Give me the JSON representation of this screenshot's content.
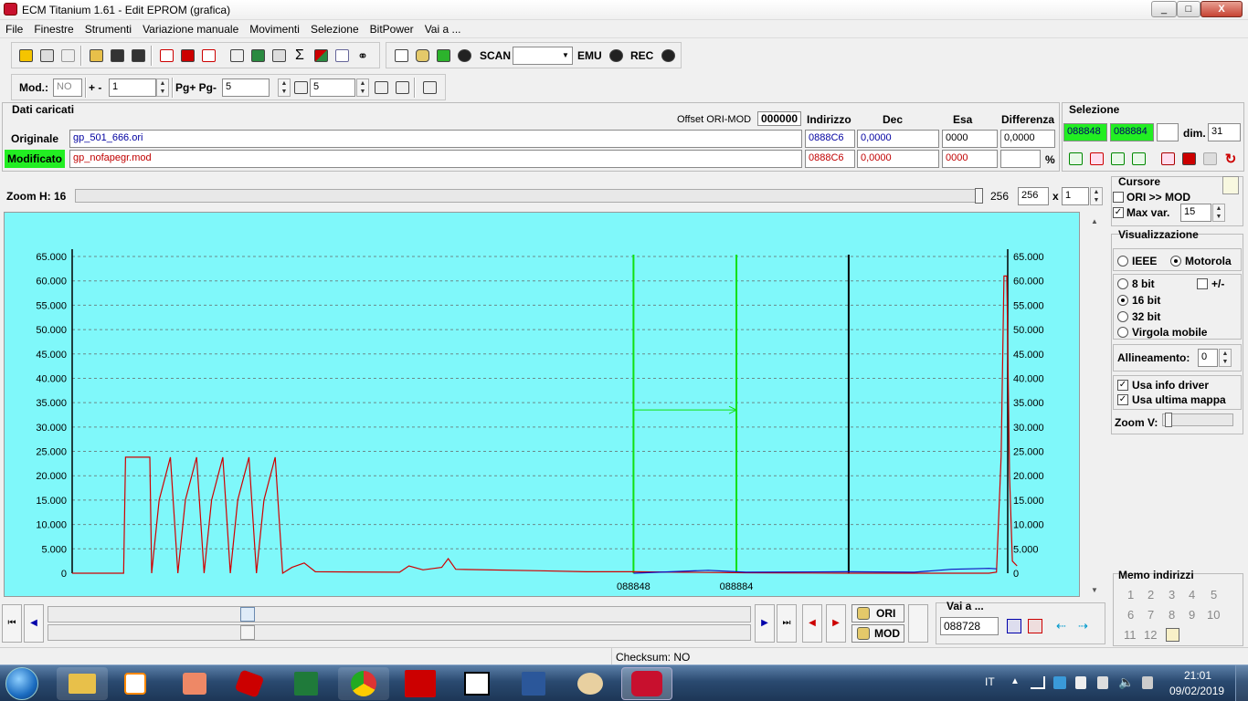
{
  "window": {
    "title": "ECM Titanium 1.61 - Edit EPROM (grafica)",
    "min": "_",
    "max": "□",
    "close": "X"
  },
  "menu": [
    "File",
    "Finestre",
    "Strumenti",
    "Variazione manuale",
    "Movimenti",
    "Selezione",
    "BitPower",
    "Vai a ..."
  ],
  "toolbar": {
    "scan_label": "SCAN",
    "emu_label": "EMU",
    "rec_label": "REC",
    "mod_label": "Mod.:",
    "mod_value": "NO",
    "plusminus_label": "+ -",
    "plusminus_value": "1",
    "pg_label": "Pg+ Pg-",
    "pg_value": "5",
    "p_value": "5"
  },
  "loaded": {
    "title": "Dati caricati",
    "offset_label": "Offset ORI-MOD",
    "offset_value": "000000",
    "col_indirizzo": "Indirizzo",
    "col_dec": "Dec",
    "col_esa": "Esa",
    "col_diff": "Differenza",
    "originale_label": "Originale",
    "originale_file": "gp_501_666.ori",
    "originale_addr": "0888C6",
    "originale_dec": "0,0000",
    "originale_esa": "0000",
    "originale_diff": "0,0000",
    "modificato_label": "Modificato",
    "modificato_file": "gp_nofapegr.mod",
    "modificato_addr": "0888C6",
    "modificato_dec": "0,0000",
    "modificato_esa": "0000",
    "percent": "%"
  },
  "selezione": {
    "title": "Selezione",
    "start": "088848",
    "end": "088884",
    "dim_label": "dim.",
    "dim_value": "31"
  },
  "zoom": {
    "label": "Zoom H: 16",
    "value1": "256",
    "value2": "256",
    "x": "x",
    "mult": "1",
    "slider_position": 1.0
  },
  "cursore": {
    "title": "Cursore",
    "ori_mod": "ORI >> MOD",
    "ori_mod_checked": false,
    "max_var": "Max var.",
    "max_var_checked": true,
    "max_var_value": "15"
  },
  "visualizzazione": {
    "title": "Visualizzazione",
    "ieee": "IEEE",
    "motorola": "Motorola",
    "bit8": "8 bit",
    "plusminus": "+/-",
    "bit16": "16 bit",
    "bit32": "32 bit",
    "virgola": "Virgola mobile",
    "allineamento_label": "Allineamento:",
    "allineamento_value": "0",
    "usa_info": "Usa info driver",
    "usa_ultima": "Usa ultima mappa",
    "zoom_v": "Zoom V:"
  },
  "memo": {
    "title": "Memo indirizzi",
    "numbers": [
      "1",
      "2",
      "3",
      "4",
      "5",
      "6",
      "7",
      "8",
      "9",
      "10",
      "11",
      "12"
    ]
  },
  "bottom": {
    "ori_btn": "ORI",
    "mod_btn": "MOD",
    "vai_label": "Vai a ...",
    "vai_value": "088728",
    "checksum": "Checksum: NO"
  },
  "taskbar": {
    "lang": "IT",
    "time": "21:01",
    "date": "09/02/2019",
    "apps": [
      "explorer",
      "media",
      "setup",
      "gem",
      "excel",
      "chrome",
      "ecm",
      "7z",
      "word",
      "paint",
      "ecm-titanium"
    ]
  },
  "chart_data": {
    "type": "line",
    "ylim": [
      0,
      65000
    ],
    "yticks": [
      "65.000",
      "60.000",
      "55.000",
      "50.000",
      "45.000",
      "40.000",
      "35.000",
      "30.000",
      "25.000",
      "20.000",
      "15.000",
      "10.000",
      "5.000",
      "0"
    ],
    "xtick_labels": [
      "088848",
      "088884"
    ],
    "selection_start_x": 0.6,
    "selection_end_x": 0.71,
    "cursor_x": 0.83,
    "series": [
      {
        "color": "#d00000",
        "points": [
          [
            0,
            0
          ],
          [
            0.055,
            0
          ],
          [
            0.057,
            23800
          ],
          [
            0.083,
            23800
          ],
          [
            0.085,
            0
          ],
          [
            0.093,
            15000
          ],
          [
            0.105,
            23800
          ],
          [
            0.113,
            0
          ],
          [
            0.121,
            15000
          ],
          [
            0.133,
            23800
          ],
          [
            0.141,
            0
          ],
          [
            0.149,
            15000
          ],
          [
            0.161,
            23800
          ],
          [
            0.169,
            0
          ],
          [
            0.177,
            15000
          ],
          [
            0.189,
            23800
          ],
          [
            0.197,
            0
          ],
          [
            0.205,
            15000
          ],
          [
            0.217,
            23800
          ],
          [
            0.225,
            0
          ],
          [
            0.235,
            1200
          ],
          [
            0.248,
            2100
          ],
          [
            0.26,
            300
          ],
          [
            0.35,
            200
          ],
          [
            0.36,
            1500
          ],
          [
            0.375,
            700
          ],
          [
            0.395,
            1200
          ],
          [
            0.402,
            3000
          ],
          [
            0.41,
            800
          ],
          [
            0.5,
            500
          ],
          [
            0.55,
            300
          ],
          [
            0.6,
            300
          ],
          [
            0.65,
            200
          ],
          [
            0.72,
            100
          ],
          [
            0.83,
            0
          ],
          [
            0.98,
            0
          ],
          [
            0.988,
            200
          ],
          [
            0.993,
            24000
          ],
          [
            0.996,
            61000
          ],
          [
            0.999,
            61000
          ],
          [
            1.002,
            20000
          ],
          [
            1.005,
            2500
          ],
          [
            1.01,
            1500
          ]
        ]
      },
      {
        "color": "#1010c0",
        "points": [
          [
            0.6,
            0
          ],
          [
            0.64,
            300
          ],
          [
            0.68,
            600
          ],
          [
            0.72,
            200
          ],
          [
            0.83,
            300
          ],
          [
            0.9,
            200
          ],
          [
            0.94,
            800
          ],
          [
            0.98,
            1000
          ],
          [
            0.988,
            900
          ]
        ]
      }
    ]
  }
}
